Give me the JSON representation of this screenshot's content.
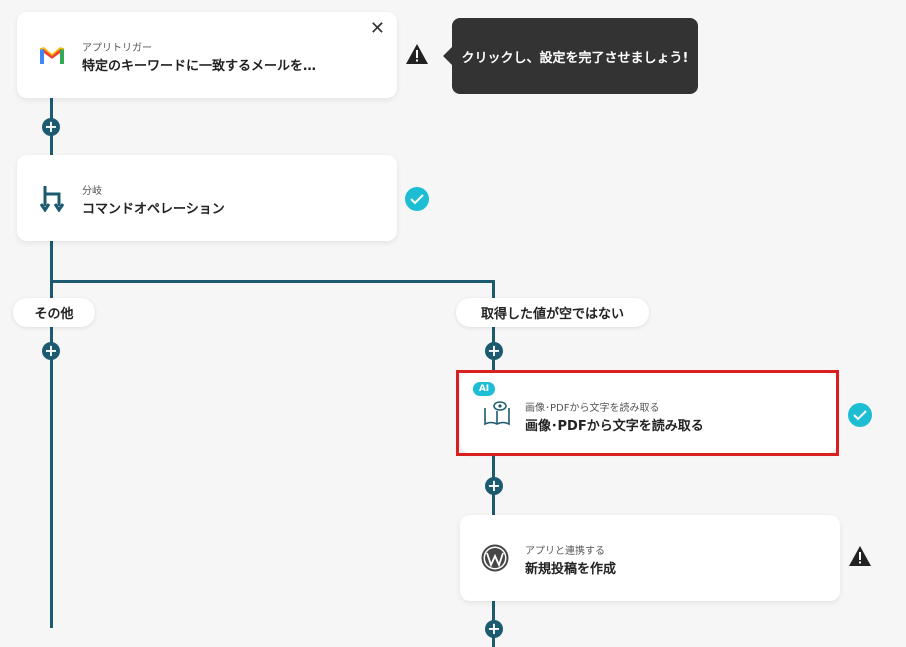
{
  "tooltip": {
    "text": "クリックし、設定を完了させましょう!"
  },
  "trigger_card": {
    "sub": "アプリトリガー",
    "title": "特定のキーワードに一致するメールを…",
    "icon": "gmail-icon"
  },
  "branch_card": {
    "sub": "分岐",
    "title": "コマンドオペレーション",
    "icon": "branch-icon"
  },
  "branches": {
    "left_label": "その他",
    "right_label": "取得した値が空ではない"
  },
  "ocr_card": {
    "badge": "AI",
    "sub": "画像･PDFから文字を読み取る",
    "title": "画像･PDFから文字を読み取る",
    "icon": "book-eye-icon"
  },
  "wp_card": {
    "sub": "アプリと連携する",
    "title": "新規投稿を作成",
    "icon": "wordpress-icon"
  },
  "colors": {
    "line": "#1c5a70",
    "check": "#1dbed4",
    "highlight": "#d92020",
    "tooltip_bg": "#333333"
  }
}
